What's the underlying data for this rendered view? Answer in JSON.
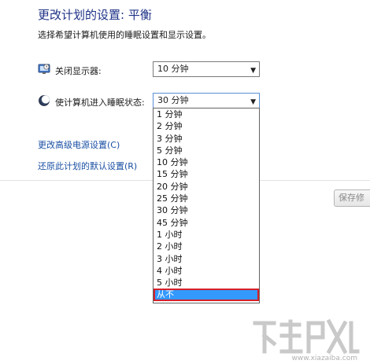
{
  "header": {
    "title": "更改计划的设置: 平衡",
    "subtitle": "选择希望计算机使用的睡眠设置和显示设置。"
  },
  "settings": {
    "display": {
      "label": "关闭显示器:",
      "value": "10 分钟",
      "icon": "monitor-icon"
    },
    "sleep": {
      "label": "使计算机进入睡眠状态:",
      "value": "30 分钟",
      "icon": "moon-icon"
    }
  },
  "links": {
    "advanced": "更改高级电源设置(C)",
    "restore": "还原此计划的默认设置(R)"
  },
  "buttons": {
    "save": "保存修"
  },
  "dropdown": {
    "options": [
      "1 分钟",
      "2 分钟",
      "3 分钟",
      "5 分钟",
      "10 分钟",
      "15 分钟",
      "20 分钟",
      "25 分钟",
      "30 分钟",
      "45 分钟",
      "1 小时",
      "2 小时",
      "3 小时",
      "4 小时",
      "5 小时",
      "从不"
    ],
    "selected_index": 15
  },
  "watermark": {
    "url": "www.xiazaiba.com"
  },
  "colors": {
    "title": "#1e3287",
    "link": "#1a4fa3",
    "highlight": "#3399ff",
    "highlight_box": "#d6202a"
  }
}
